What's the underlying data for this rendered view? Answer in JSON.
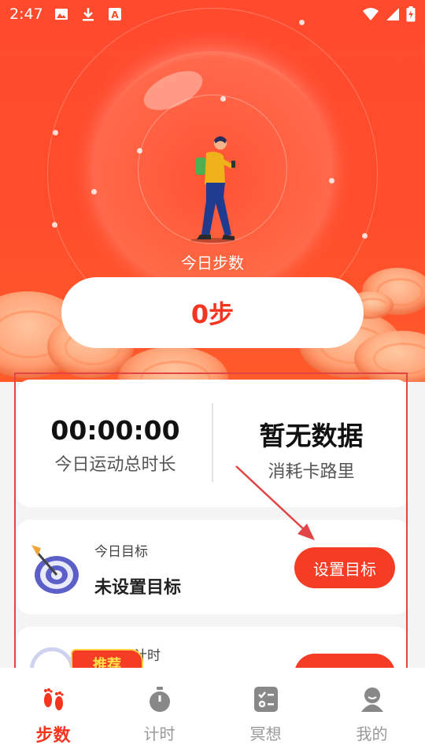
{
  "status_bar": {
    "time": "2:47",
    "icons": [
      "image-icon",
      "download-icon",
      "a-icon"
    ],
    "right_icons": [
      "wifi-icon",
      "signal-icon",
      "battery-icon"
    ]
  },
  "hero": {
    "label": "今日步数",
    "steps": "0步"
  },
  "stats": {
    "duration_value": "00:00:00",
    "duration_label": "今日运动总时长",
    "calories_value": "暂无数据",
    "calories_label": "消耗卡路里"
  },
  "goal": {
    "subtitle": "今日目标",
    "title": "未设置目标",
    "button": "设置目标"
  },
  "timer_card": {
    "subtitle": "计时",
    "badge": "推荐"
  },
  "nav": {
    "items": [
      {
        "label": "步数",
        "icon": "footprints-icon",
        "active": true
      },
      {
        "label": "计时",
        "icon": "stopwatch-icon",
        "active": false
      },
      {
        "label": "冥想",
        "icon": "checklist-icon",
        "active": false
      },
      {
        "label": "我的",
        "icon": "user-icon",
        "active": false
      }
    ]
  },
  "colors": {
    "accent": "#f53c24",
    "hero_bg": "#ff4a2e",
    "badge_text": "#ffe14a"
  }
}
